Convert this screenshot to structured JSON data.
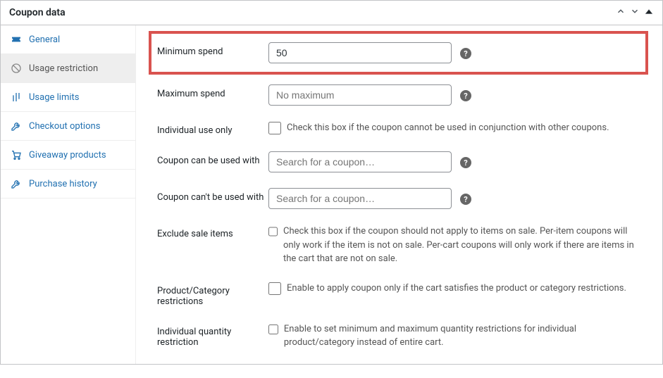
{
  "header": {
    "title": "Coupon data"
  },
  "sidebar": {
    "items": [
      {
        "label": "General"
      },
      {
        "label": "Usage restriction"
      },
      {
        "label": "Usage limits"
      },
      {
        "label": "Checkout options"
      },
      {
        "label": "Giveaway products"
      },
      {
        "label": "Purchase history"
      }
    ]
  },
  "form": {
    "minimum_spend": {
      "label": "Minimum spend",
      "value": "50"
    },
    "maximum_spend": {
      "label": "Maximum spend",
      "placeholder": "No maximum"
    },
    "individual_use": {
      "label": "Individual use only",
      "desc": "Check this box if the coupon cannot be used in conjunction with other coupons."
    },
    "used_with": {
      "label": "Coupon can be used with",
      "placeholder": "Search for a coupon…"
    },
    "not_used_with": {
      "label": "Coupon can't be used with",
      "placeholder": "Search for a coupon…"
    },
    "exclude_sale": {
      "label": "Exclude sale items",
      "desc": "Check this box if the coupon should not apply to items on sale. Per-item coupons will only work if the item is not on sale. Per-cart coupons will only work if there are items in the cart that are not on sale."
    },
    "product_category": {
      "label": "Product/Category restrictions",
      "desc": "Enable to apply coupon only if the cart satisfies the product or category restrictions."
    },
    "individual_qty": {
      "label": "Individual quantity restriction",
      "desc": "Enable to set minimum and maximum quantity restrictions for individual product/category instead of entire cart."
    }
  }
}
